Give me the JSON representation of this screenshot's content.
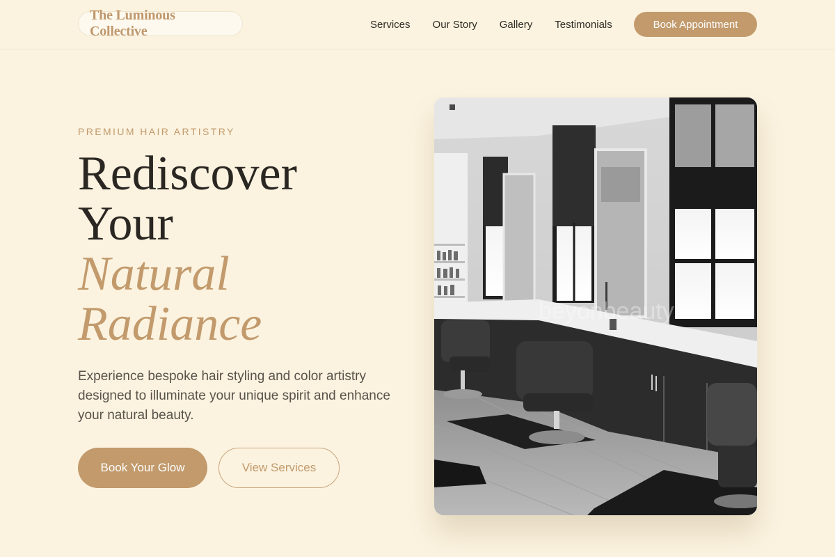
{
  "header": {
    "logo_text": "The Luminous Collective",
    "nav": [
      {
        "label": "Services"
      },
      {
        "label": "Our Story"
      },
      {
        "label": "Gallery"
      },
      {
        "label": "Testimonials"
      }
    ],
    "cta_label": "Book Appointment"
  },
  "hero": {
    "eyebrow": "PREMIUM HAIR ARTISTRY",
    "headline_line1": "Rediscover",
    "headline_line2": "Your",
    "headline_accent1": "Natural",
    "headline_accent2": "Radiance",
    "subtext": "Experience bespoke hair styling and color artistry designed to illuminate your unique spirit and enhance your natural beauty.",
    "primary_button": "Book Your Glow",
    "secondary_button": "View Services",
    "image_watermark": "beyonbeauty"
  },
  "colors": {
    "background": "#fbf3e0",
    "accent": "#c29a6c",
    "text": "#2a2622",
    "muted_text": "#5a524a"
  }
}
